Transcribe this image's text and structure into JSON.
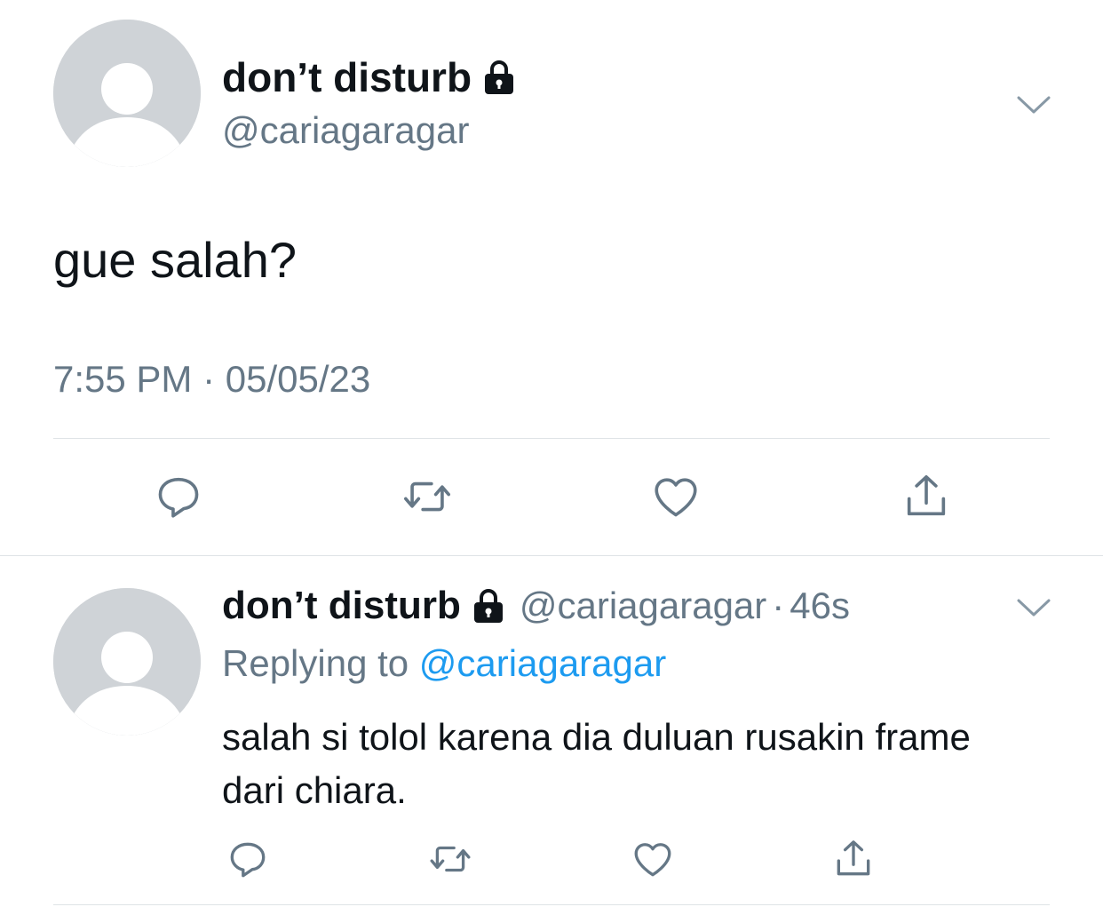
{
  "main_tweet": {
    "display_name": "don’t disturb",
    "handle": "@cariagaragar",
    "text": "gue salah?",
    "timestamp": "7:55 PM · 05/05/23",
    "verified_lock_icon": "lock-icon",
    "actions": [
      "reply-icon",
      "retweet-icon",
      "like-icon",
      "share-icon"
    ]
  },
  "reply_tweet": {
    "display_name": "don’t disturb",
    "handle": "@cariagaragar",
    "separator": "·",
    "time_ago": "46s",
    "replying_prefix": "Replying to",
    "replying_to": "@cariagaragar",
    "text": "salah si tolol karena dia duluan rusakin frame dari chiara.",
    "actions": [
      "reply-icon",
      "retweet-icon",
      "like-icon",
      "share-icon"
    ]
  },
  "colors": {
    "text_primary": "#0f1419",
    "text_secondary": "#657786",
    "link": "#1d9bf0",
    "divider": "#dfe3e6",
    "avatar_bg": "#cfd3d7"
  }
}
